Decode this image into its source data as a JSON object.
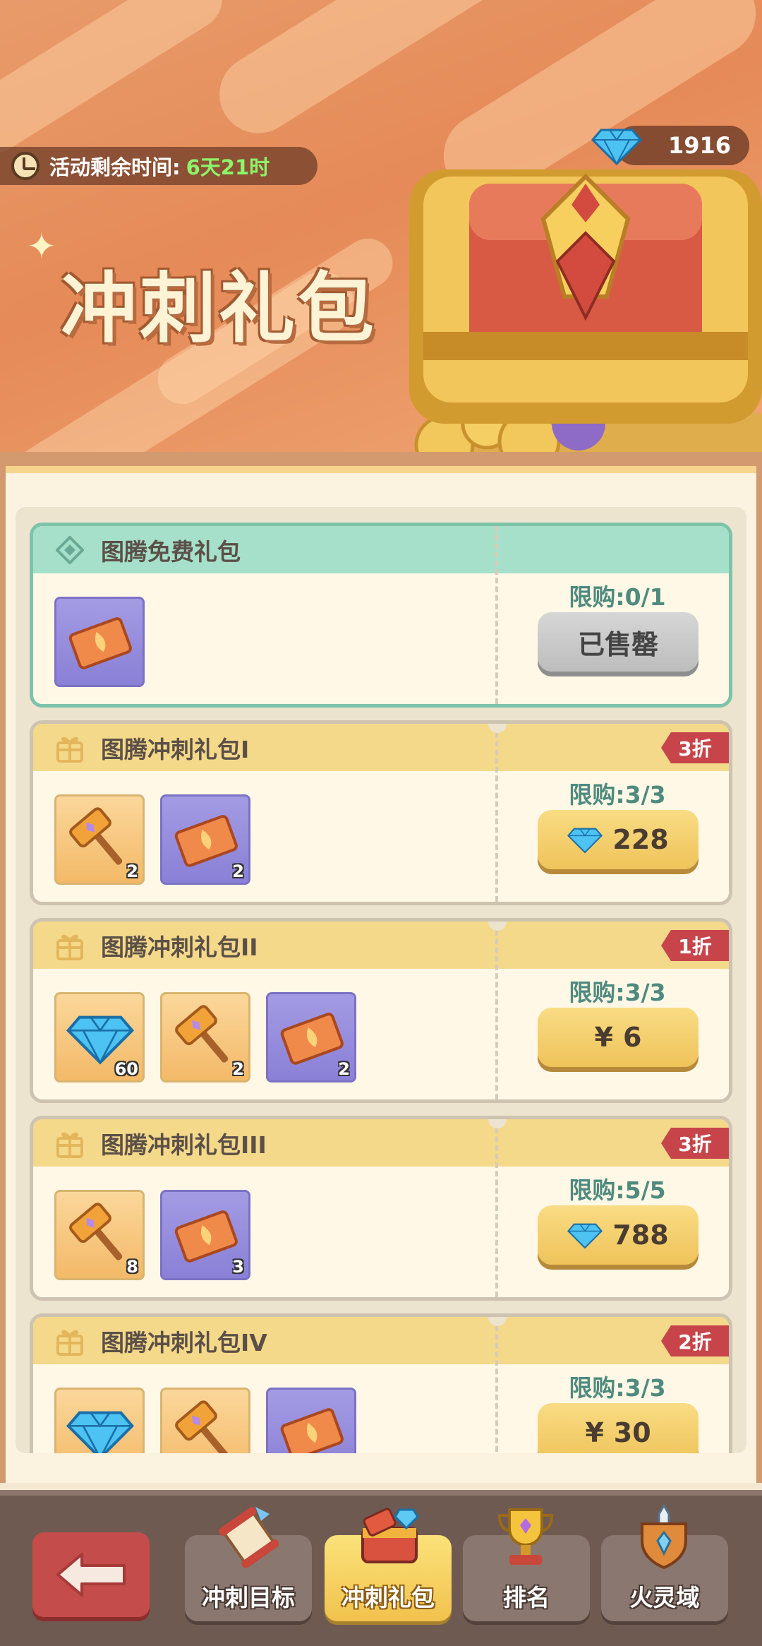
{
  "header": {
    "timer_label": "活动剩余时间:",
    "timer_value": "6天21时",
    "gem_balance": "1916",
    "title": "冲刺礼包"
  },
  "packs": [
    {
      "name": "图腾免费礼包",
      "limit": "限购:0/1",
      "price": "已售罄",
      "price_icon": "",
      "discount": "",
      "sold_out": true,
      "items": [
        {
          "kind": "ticket-icon",
          "count": ""
        }
      ]
    },
    {
      "name": "图腾冲刺礼包I",
      "limit": "限购:3/3",
      "price": "228",
      "price_icon": "gem-icon",
      "discount": "3折",
      "items": [
        {
          "kind": "hammer-icon",
          "count": "2"
        },
        {
          "kind": "ticket-icon",
          "count": "2"
        }
      ]
    },
    {
      "name": "图腾冲刺礼包II",
      "limit": "限购:3/3",
      "price": "6",
      "price_icon": "yen",
      "price_prefix": "¥",
      "discount": "1折",
      "items": [
        {
          "kind": "gem-icon",
          "count": "60"
        },
        {
          "kind": "hammer-icon",
          "count": "2"
        },
        {
          "kind": "ticket-icon",
          "count": "2"
        }
      ]
    },
    {
      "name": "图腾冲刺礼包III",
      "limit": "限购:5/5",
      "price": "788",
      "price_icon": "gem-icon",
      "discount": "3折",
      "items": [
        {
          "kind": "hammer-icon",
          "count": "8"
        },
        {
          "kind": "ticket-icon",
          "count": "3"
        }
      ]
    },
    {
      "name": "图腾冲刺礼包IV",
      "limit": "限购:3/3",
      "price": "30",
      "price_icon": "yen",
      "price_prefix": "¥",
      "discount": "2折",
      "items": [
        {
          "kind": "gem-icon",
          "count": ""
        },
        {
          "kind": "hammer-icon",
          "count": ""
        },
        {
          "kind": "ticket-icon",
          "count": ""
        }
      ]
    }
  ],
  "nav": {
    "tabs": [
      {
        "label": "冲刺目标",
        "icon": "scroll-icon"
      },
      {
        "label": "冲刺礼包",
        "icon": "gift-chest-icon",
        "active": true
      },
      {
        "label": "排名",
        "icon": "trophy-icon"
      },
      {
        "label": "火灵域",
        "icon": "sword-shield-icon"
      }
    ]
  },
  "colors": {
    "accent_gold": "#f1c24d",
    "discount_red": "#c7454a",
    "timer_green": "#8cf56a",
    "free_teal": "#a6e0cb"
  }
}
